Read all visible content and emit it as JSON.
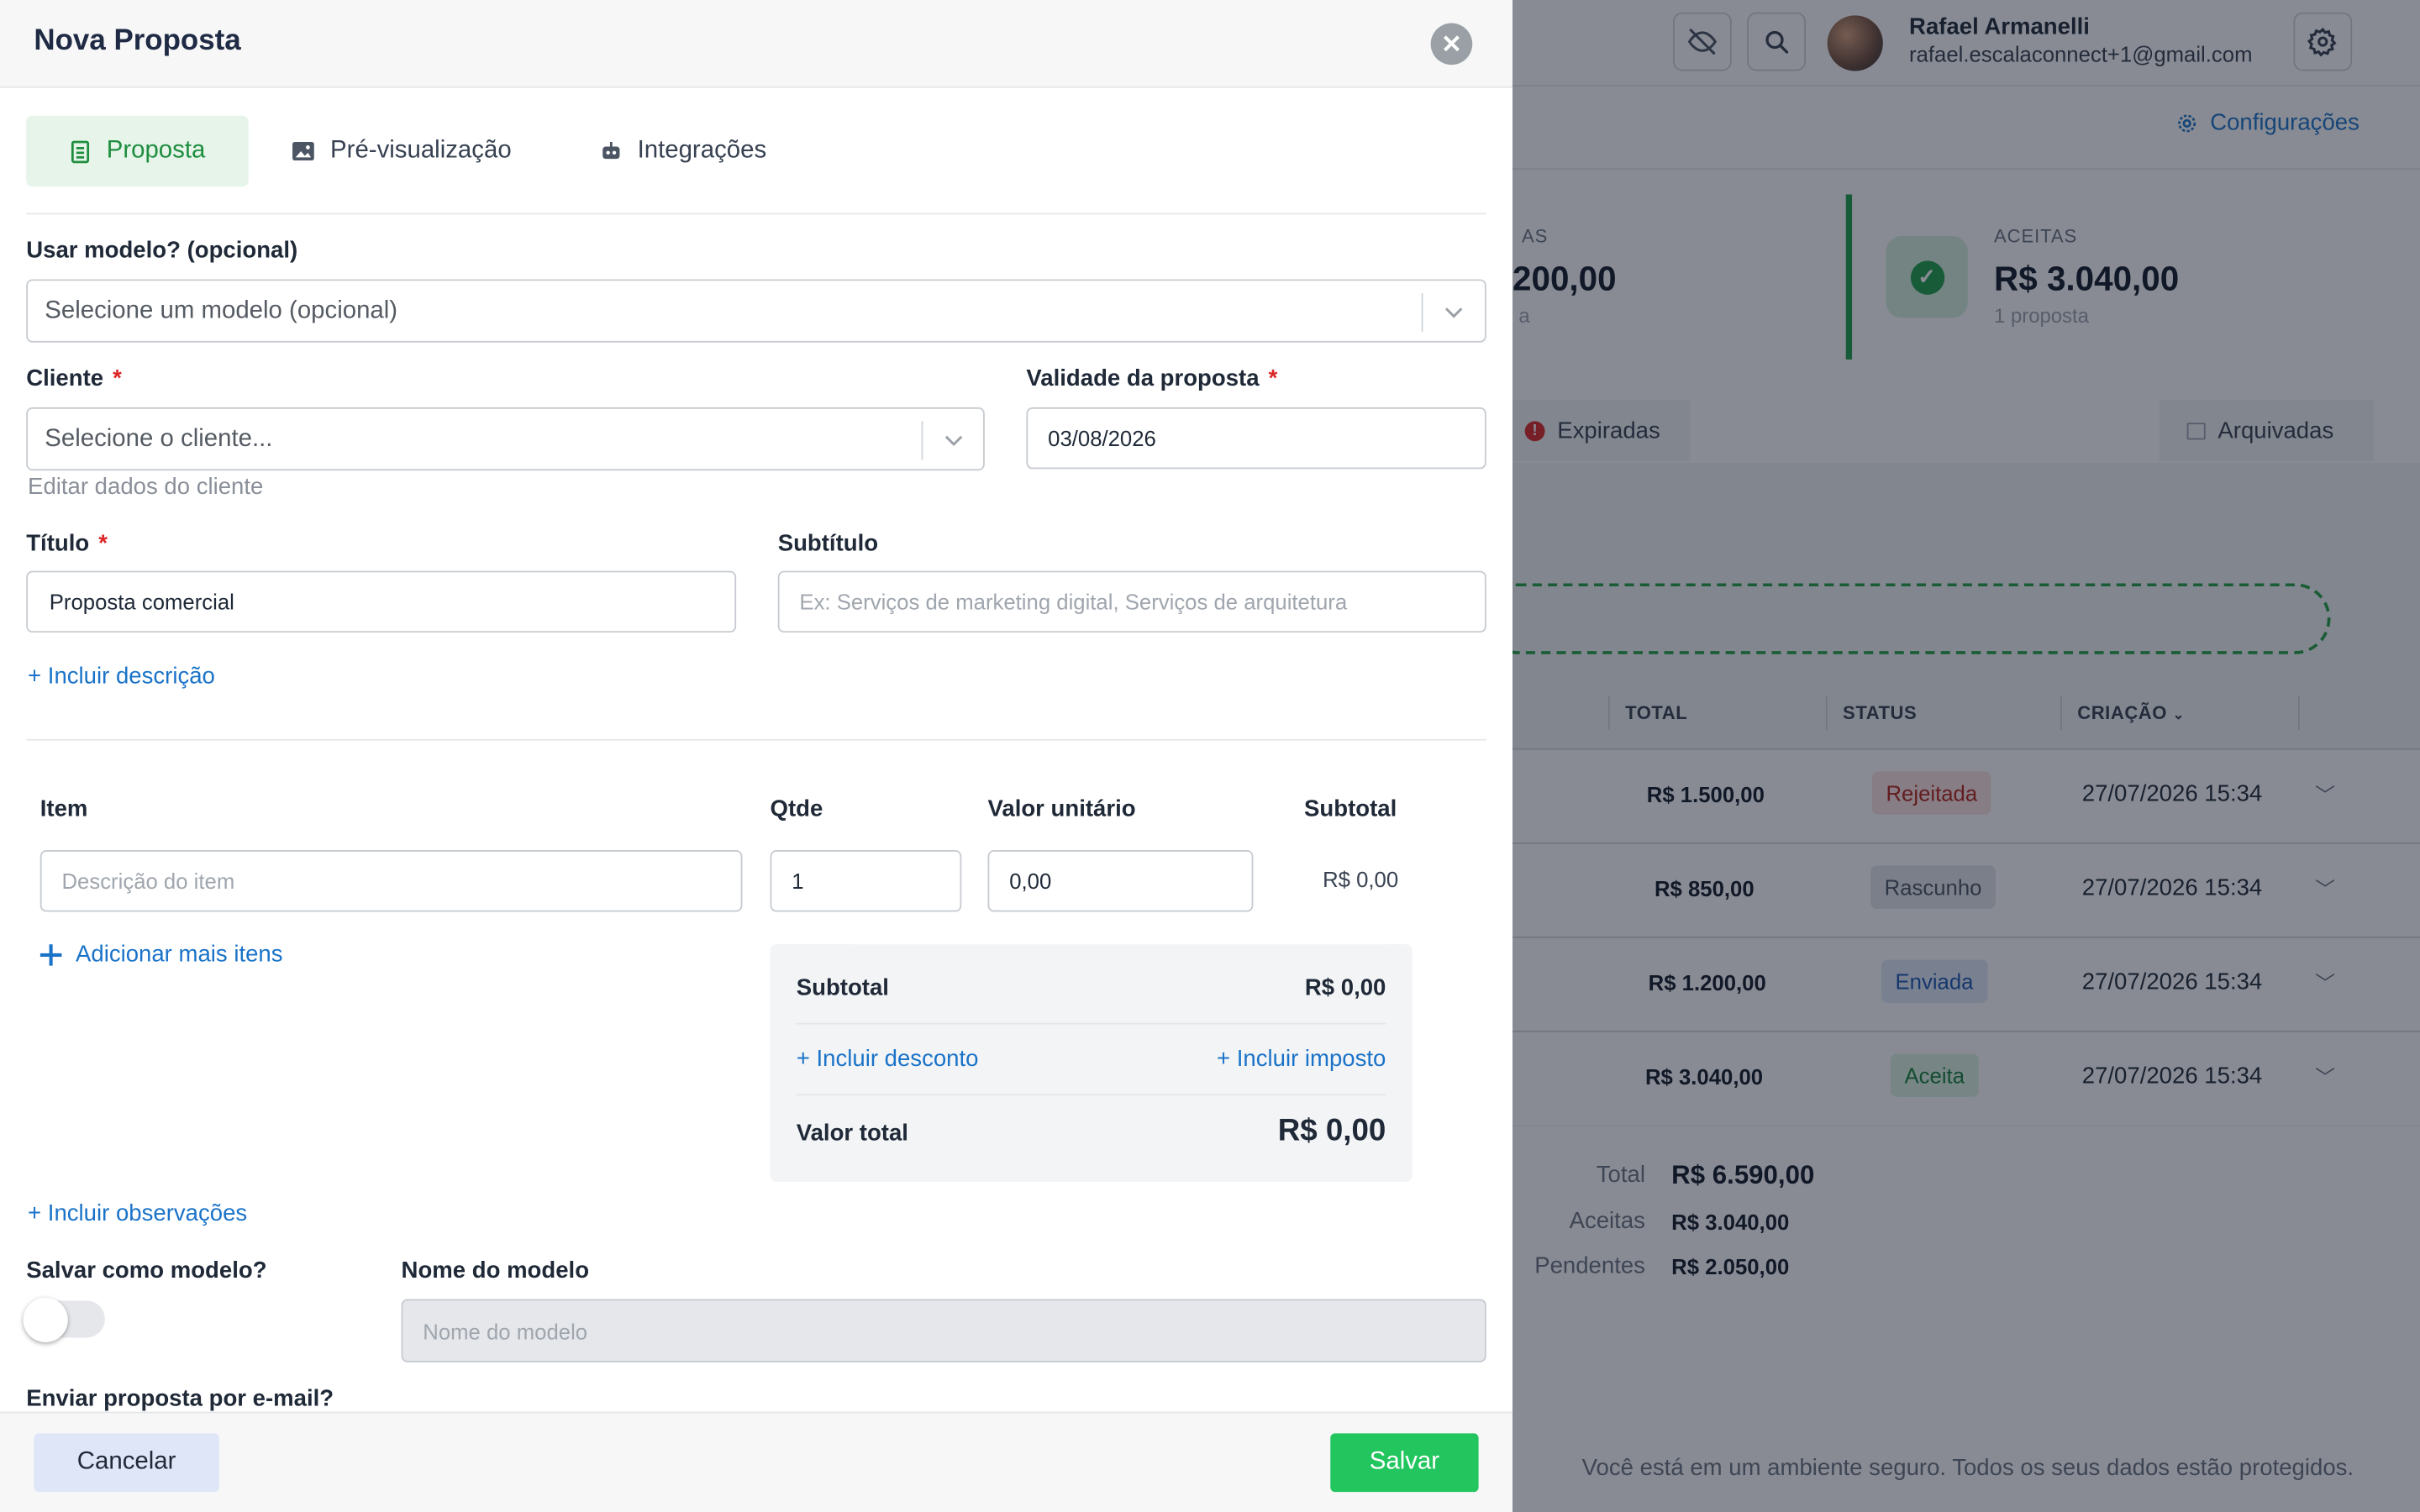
{
  "background": {
    "user": {
      "name": "Rafael Armanelli",
      "email": "rafael.escalaconnect+1@gmail.com"
    },
    "config_link": "Configurações",
    "cards": [
      {
        "label": "AS",
        "value": "200,00",
        "sub": "a"
      },
      {
        "label": "ACEITAS",
        "value": "R$ 3.040,00",
        "sub": "1 proposta"
      }
    ],
    "tabs": {
      "expired": "Expiradas",
      "archived": "Arquivadas"
    },
    "table": {
      "headers": {
        "total": "TOTAL",
        "status": "STATUS",
        "created": "CRIAÇÃO"
      },
      "rows": [
        {
          "total": "R$ 1.500,00",
          "status": "Rejeitada",
          "date": "27/07/2026 15:34"
        },
        {
          "total": "R$ 850,00",
          "status": "Rascunho",
          "date": "27/07/2026 15:34"
        },
        {
          "total": "R$ 1.200,00",
          "status": "Enviada",
          "date": "27/07/2026 15:34"
        },
        {
          "total": "R$ 3.040,00",
          "status": "Aceita",
          "date": "27/07/2026 15:34"
        }
      ]
    },
    "summary": {
      "total_label": "Total",
      "total_value": "R$ 6.590,00",
      "accepted_label": "Aceitas",
      "accepted_value": "R$ 3.040,00",
      "pending_label": "Pendentes",
      "pending_value": "R$ 2.050,00"
    },
    "footer_note": "Você está em um ambiente seguro. Todos os seus dados estão protegidos."
  },
  "modal": {
    "title": "Nova Proposta",
    "tabs": {
      "proposal": "Proposta",
      "preview": "Pré-visualização",
      "integrations": "Integrações"
    },
    "template": {
      "label": "Usar modelo? (opcional)",
      "placeholder": "Selecione um modelo (opcional)"
    },
    "client": {
      "label": "Cliente",
      "required": "*",
      "placeholder": "Selecione o cliente...",
      "edit_link": "Editar dados do cliente"
    },
    "validity": {
      "label": "Validade da proposta",
      "required": "*",
      "value": "03/08/2026"
    },
    "title_field": {
      "label": "Título",
      "required": "*",
      "value": "Proposta comercial"
    },
    "subtitle": {
      "label": "Subtítulo",
      "placeholder": "Ex: Serviços de marketing digital, Serviços de arquitetura"
    },
    "include_description": "+ Incluir descrição",
    "items": {
      "headers": {
        "item": "Item",
        "qty": "Qtde",
        "unit_value": "Valor unitário",
        "subtotal": "Subtotal"
      },
      "row": {
        "description_placeholder": "Descrição do item",
        "qty": "1",
        "unit_value": "0,00",
        "subtotal": "R$ 0,00"
      },
      "add_more": "Adicionar mais itens"
    },
    "summary": {
      "subtotal_label": "Subtotal",
      "subtotal_value": "R$ 0,00",
      "discount_link": "+ Incluir desconto",
      "tax_link": "+ Incluir imposto",
      "total_label": "Valor total",
      "total_value": "R$ 0,00"
    },
    "include_notes": "+ Incluir observações",
    "save_as_template": {
      "label": "Salvar como modelo?",
      "enabled": false
    },
    "template_name": {
      "label": "Nome do modelo",
      "placeholder": "Nome do modelo"
    },
    "send_email_label": "Enviar proposta por e-mail?",
    "buttons": {
      "cancel": "Cancelar",
      "save": "Salvar"
    }
  },
  "colors": {
    "accent_green": "#22c55e",
    "link_blue": "#1a73c8",
    "active_tab_bg": "#e6f4ea"
  }
}
